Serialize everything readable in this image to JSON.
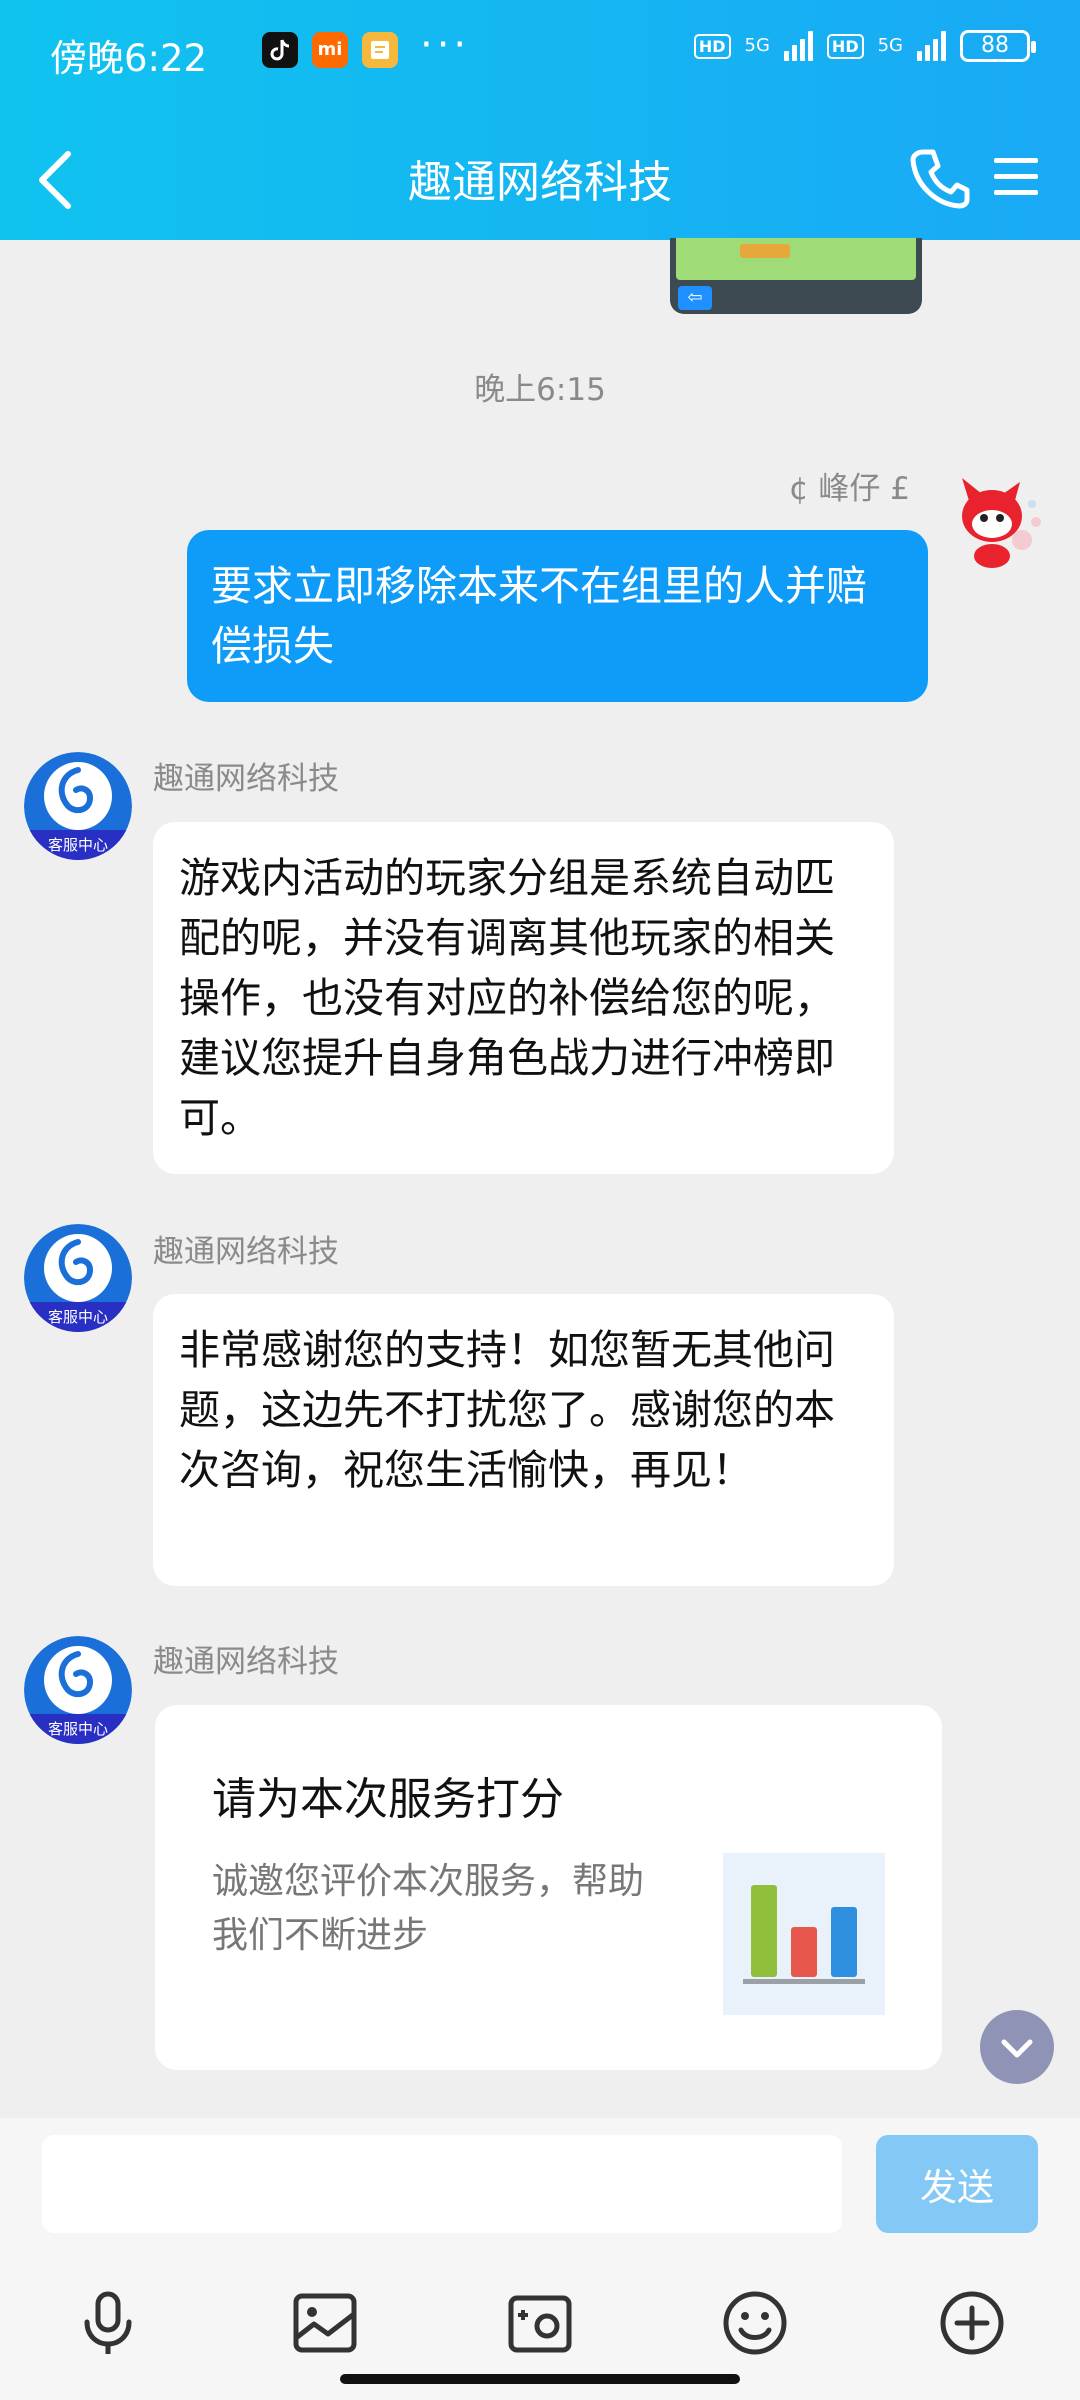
{
  "status_bar": {
    "time": "傍晚6:22",
    "dots": "···",
    "hd1": "HD",
    "net1": "5G",
    "hd2": "HD",
    "net2": "5G",
    "battery": "88"
  },
  "nav": {
    "title": "趣通网络科技"
  },
  "chat": {
    "timestamp": "晚上6:15",
    "my_name": "¢ 峰仔 £",
    "my_message": "要求立即移除本来不在组里的人并赔偿损失",
    "messages": [
      {
        "sender": "趣通网络科技",
        "avatar_label": "客服中心",
        "text": "游戏内活动的玩家分组是系统自动匹配的呢，并没有调离其他玩家的相关操作，也没有对应的补偿给您的呢，建议您提升自身角色战力进行冲榜即可。"
      },
      {
        "sender": "趣通网络科技",
        "avatar_label": "客服中心",
        "text": "非常感谢您的支持！如您暂无其他问题，这边先不打扰您了。感谢您的本次咨询，祝您生活愉快，再见！"
      },
      {
        "sender": "趣通网络科技",
        "avatar_label": "客服中心"
      }
    ],
    "rating_card": {
      "title": "请为本次服务打分",
      "description": "诚邀您评价本次服务，帮助我们不断进步",
      "chart_colors": [
        "#8fbf3b",
        "#e8574b",
        "#2f8fe0"
      ]
    }
  },
  "input": {
    "value": "",
    "placeholder": "",
    "send_label": "发送"
  },
  "icons": {
    "back": "chevron-left-icon",
    "phone": "phone-icon",
    "menu": "menu-icon",
    "voice": "microphone-icon",
    "image": "image-icon",
    "camera": "camera-icon",
    "emoji": "emoji-icon",
    "more": "plus-circle-icon"
  },
  "colors": {
    "header_start": "#10c3ef",
    "header_end": "#19a9f5",
    "my_bubble": "#0f9cf9",
    "send_button": "#84c9f5"
  }
}
